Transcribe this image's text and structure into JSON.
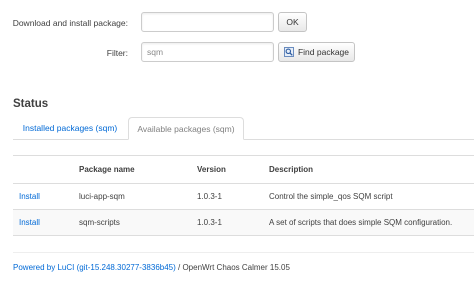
{
  "form": {
    "download_label": "Download and install package:",
    "download_value": "",
    "ok_label": "OK",
    "filter_label": "Filter:",
    "filter_value": "sqm",
    "find_label": "Find package"
  },
  "status": {
    "title": "Status",
    "tabs": [
      {
        "label": "Installed packages (sqm)",
        "active": false
      },
      {
        "label": "Available packages (sqm)",
        "active": true
      }
    ]
  },
  "table": {
    "headers": [
      "",
      "Package name",
      "Version",
      "Description"
    ],
    "rows": [
      {
        "action": "Install",
        "name": "luci-app-sqm",
        "version": "1.0.3-1",
        "description": "Control the simple_qos SQM script"
      },
      {
        "action": "Install",
        "name": "sqm-scripts",
        "version": "1.0.3-1",
        "description": "A set of scripts that does simple SQM configuration."
      }
    ]
  },
  "footer": {
    "powered_by": "Powered by LuCI (git-15.248.30277-3836b45)",
    "separator": " / ",
    "version": "OpenWrt Chaos Calmer 15.05"
  },
  "colors": {
    "link": "#0069d6",
    "border": "#dddddd"
  },
  "icons": {
    "find": "find-icon"
  }
}
